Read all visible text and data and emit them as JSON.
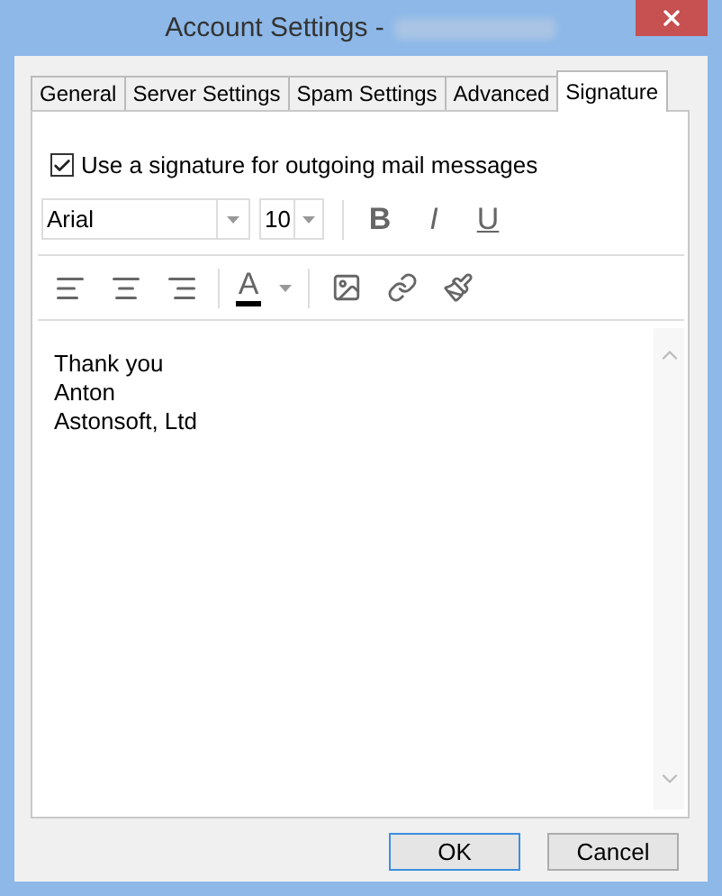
{
  "window": {
    "title": "Account Settings -"
  },
  "tabs": [
    {
      "label": "General",
      "selected": false
    },
    {
      "label": "Server Settings",
      "selected": false
    },
    {
      "label": "Spam Settings",
      "selected": false
    },
    {
      "label": "Advanced",
      "selected": false
    },
    {
      "label": "Signature",
      "selected": true
    }
  ],
  "use_signature": {
    "label": "Use a signature for outgoing mail messages",
    "checked": true
  },
  "toolbar": {
    "font": "Arial",
    "size": "10",
    "styles": [
      {
        "kind": "bold",
        "label": "B"
      },
      {
        "kind": "italic",
        "label": "I"
      },
      {
        "kind": "underline",
        "label": "U"
      }
    ],
    "font_color": {
      "label": "A",
      "color": "#000000"
    }
  },
  "editor": {
    "lines": [
      "Thank you",
      "Anton",
      "Astonsoft, Ltd"
    ]
  },
  "buttons": [
    {
      "label": "OK",
      "default": true
    },
    {
      "label": "Cancel",
      "default": false
    }
  ]
}
